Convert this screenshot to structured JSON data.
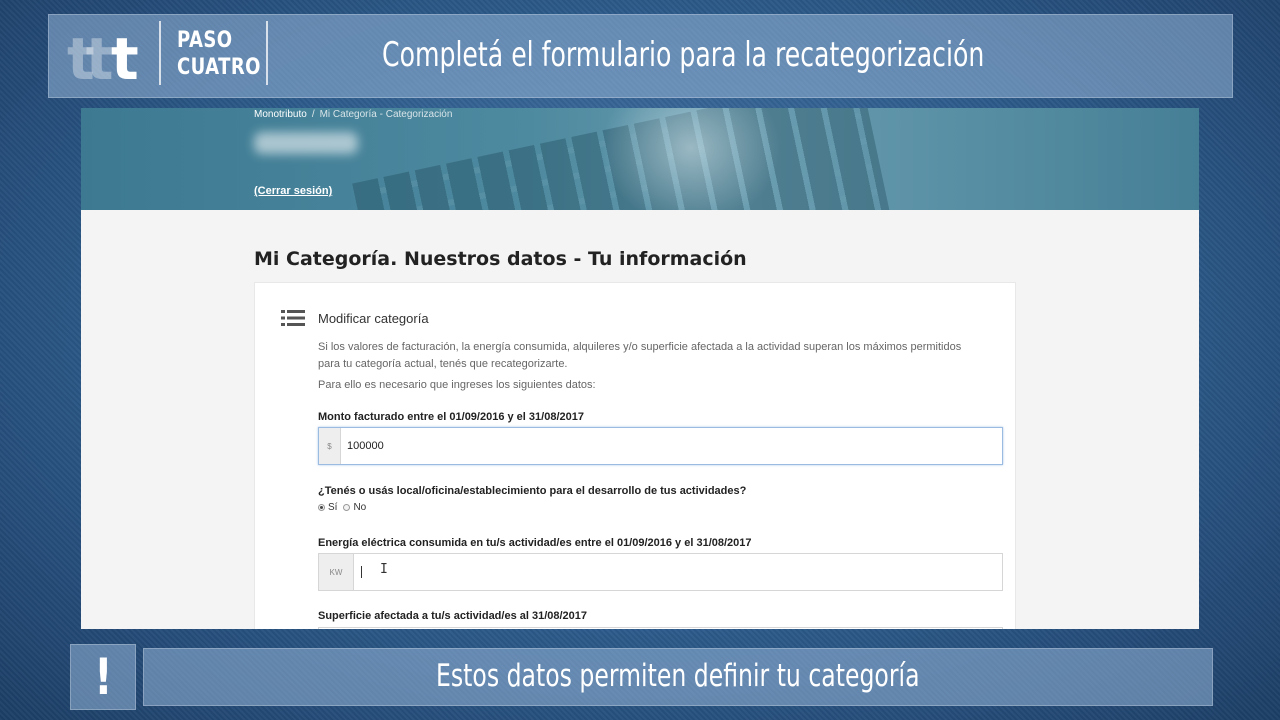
{
  "overlay": {
    "step_line1": "PASO",
    "step_line2": "CUATRO",
    "title": "Completá el formulario para la recategorización",
    "alert_mark": "!",
    "caption": "Estos datos permiten definir tu categoría"
  },
  "header": {
    "breadcrumb": [
      "Monotributo",
      "Mi Categoría - Categorización"
    ],
    "breadcrumb_separator": "/",
    "logout": "(Cerrar sesión)"
  },
  "page": {
    "title": "Mi Categoría. Nuestros datos - Tu información"
  },
  "card": {
    "icon": "list-icon",
    "title": "Modificar categoría",
    "intro": "Si los valores de facturación, la energía consumida, alquileres y/o superficie afectada a la actividad superan los máximos permitidos para tu categoría actual, tenés que recategorizarte.",
    "intro2": "Para ello es necesario que ingreses los siguientes datos:"
  },
  "form": {
    "monto": {
      "label": "Monto facturado entre el 01/09/2016 y el 31/08/2017",
      "prefix": "$",
      "value": "100000"
    },
    "local": {
      "label": "¿Tenés o usás local/oficina/establecimiento para el desarrollo de tus actividades?",
      "options": [
        "Sí",
        "No"
      ],
      "selected": "Sí"
    },
    "energia": {
      "label": "Energía eléctrica consumida en tu/s actividad/es entre el 01/09/2016 y el 31/08/2017",
      "prefix": "KW",
      "value": ""
    },
    "superficie": {
      "label": "Superficie afectada a tu/s actividad/es al 31/08/2017"
    }
  },
  "colors": {
    "hero": "#3d7a92",
    "banner": "#96b4d7",
    "background": "#2c5a8a"
  }
}
